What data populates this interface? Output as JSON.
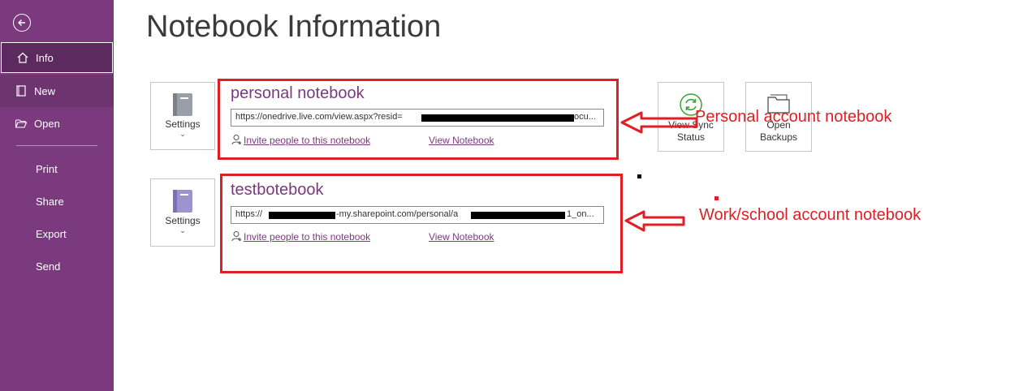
{
  "sidebar": {
    "items": [
      {
        "label": "Info"
      },
      {
        "label": "New"
      },
      {
        "label": "Open"
      },
      {
        "label": "Print"
      },
      {
        "label": "Share"
      },
      {
        "label": "Export"
      },
      {
        "label": "Send"
      }
    ],
    "colors": {
      "background": "#7a3a7d",
      "selected": "#5c2a5e",
      "hover": "#6d3470"
    }
  },
  "page": {
    "title": "Notebook Information"
  },
  "notebooks": [
    {
      "name": "personal notebook",
      "url": "https://onedrive.live.com/view.aspx?resid=",
      "url_tail": "ocu...",
      "settings_label": "Settings",
      "invite_label": "Invite people to this notebook",
      "view_label": "View Notebook"
    },
    {
      "name": "testbotebook",
      "url": "https://",
      "url_mid": "-my.sharepoint.com/personal/a",
      "url_tail": "1_on...",
      "settings_label": "Settings",
      "invite_label": "Invite people to this notebook",
      "view_label": "View Notebook"
    }
  ],
  "actions": {
    "view_sync": "View Sync Status",
    "open_backups": "Open Backups"
  },
  "annotations": {
    "personal": "Personal account notebook",
    "work": "Work/school account notebook",
    "color": "#e01e25"
  },
  "icons": [
    "back-arrow-icon",
    "home-icon",
    "new-notebook-icon",
    "folder-open-icon",
    "notebook-icon",
    "person-add-icon",
    "sync-icon",
    "folder-icon",
    "chevron-down-icon"
  ]
}
